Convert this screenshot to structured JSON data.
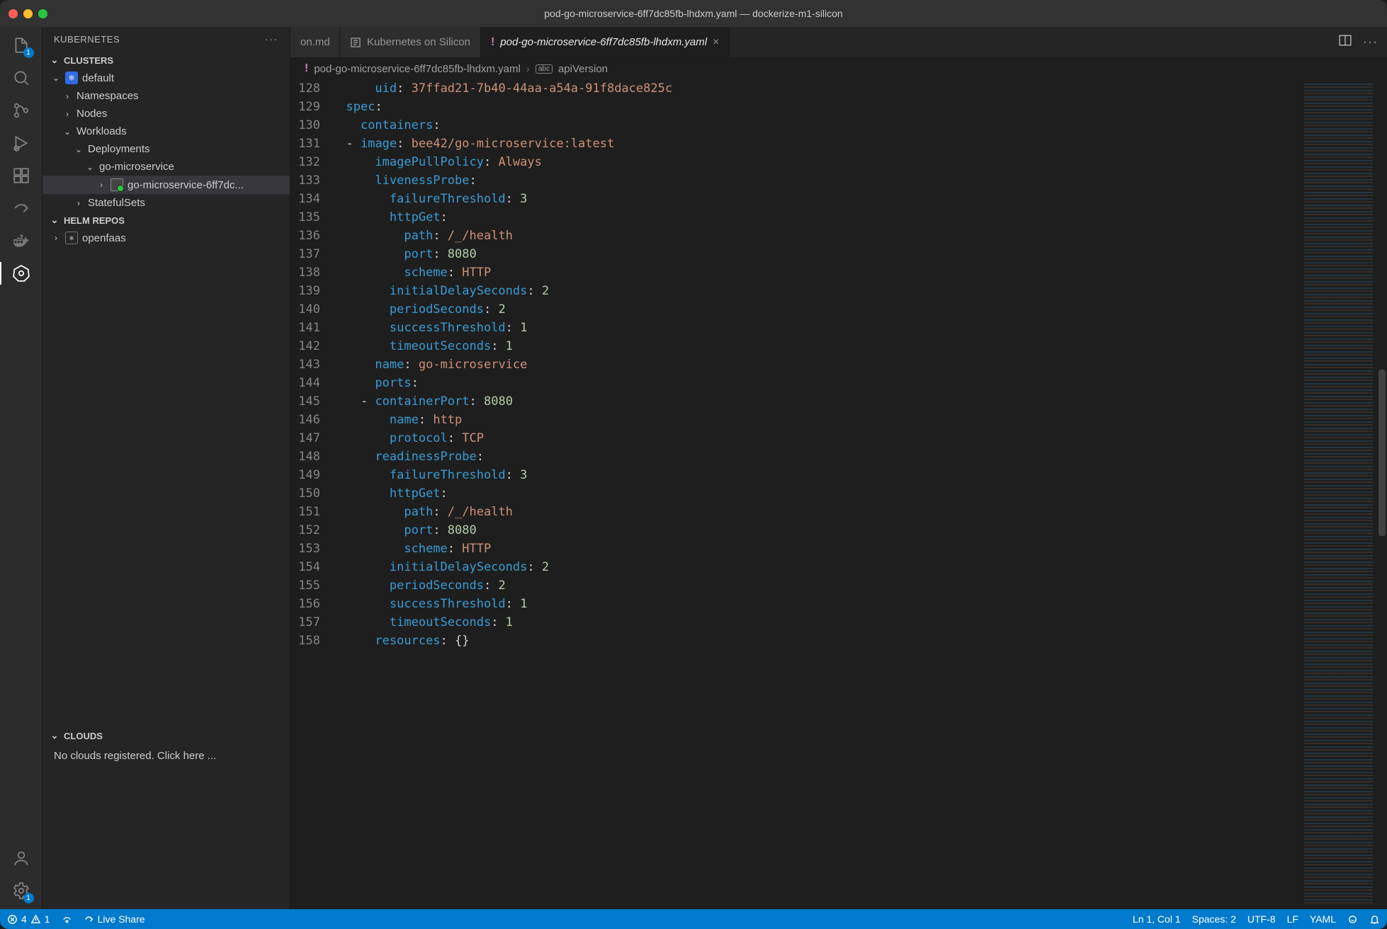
{
  "window": {
    "title": "pod-go-microservice-6ff7dc85fb-lhdxm.yaml — dockerize-m1-silicon"
  },
  "activity": {
    "explorer_badge": "1",
    "settings_badge": "1"
  },
  "sidebar": {
    "title": "KUBERNETES",
    "sections": {
      "clusters": "CLUSTERS",
      "helm": "HELM REPOS",
      "clouds": "CLOUDS"
    },
    "tree": {
      "cluster": "default",
      "namespaces": "Namespaces",
      "nodes": "Nodes",
      "workloads": "Workloads",
      "deployments": "Deployments",
      "deployment": "go-microservice",
      "pod": "go-microservice-6ff7dc...",
      "statefulsets": "StatefulSets",
      "helm_repo": "openfaas"
    },
    "clouds_msg": "No clouds registered. Click here ..."
  },
  "tabs": {
    "t0_label": "on.md",
    "t1_label": "Kubernetes on Silicon",
    "t2_label": "pod-go-microservice-6ff7dc85fb-lhdxm.yaml"
  },
  "breadcrumb": {
    "file": "pod-go-microservice-6ff7dc85fb-lhdxm.yaml",
    "symbol": "apiVersion"
  },
  "code": {
    "lines": [
      {
        "n": "128",
        "indent": 2,
        "key": "uid",
        "sep": ": ",
        "val": "37ffad21-7b40-44aa-a54a-91f8dace825c",
        "vt": "s"
      },
      {
        "n": "129",
        "indent": 0,
        "key": "spec",
        "sep": ":",
        "val": "",
        "vt": ""
      },
      {
        "n": "130",
        "indent": 1,
        "key": "containers",
        "sep": ":",
        "val": "",
        "vt": ""
      },
      {
        "n": "131",
        "indent": 1,
        "dash": true,
        "key": "image",
        "sep": ": ",
        "val": "bee42/go-microservice:latest",
        "vt": "s"
      },
      {
        "n": "132",
        "indent": 2,
        "key": "imagePullPolicy",
        "sep": ": ",
        "val": "Always",
        "vt": "s"
      },
      {
        "n": "133",
        "indent": 2,
        "key": "livenessProbe",
        "sep": ":",
        "val": "",
        "vt": ""
      },
      {
        "n": "134",
        "indent": 3,
        "key": "failureThreshold",
        "sep": ": ",
        "val": "3",
        "vt": "n"
      },
      {
        "n": "135",
        "indent": 3,
        "key": "httpGet",
        "sep": ":",
        "val": "",
        "vt": ""
      },
      {
        "n": "136",
        "indent": 4,
        "key": "path",
        "sep": ": ",
        "val": "/_/health",
        "vt": "s"
      },
      {
        "n": "137",
        "indent": 4,
        "key": "port",
        "sep": ": ",
        "val": "8080",
        "vt": "n"
      },
      {
        "n": "138",
        "indent": 4,
        "key": "scheme",
        "sep": ": ",
        "val": "HTTP",
        "vt": "s"
      },
      {
        "n": "139",
        "indent": 3,
        "key": "initialDelaySeconds",
        "sep": ": ",
        "val": "2",
        "vt": "n"
      },
      {
        "n": "140",
        "indent": 3,
        "key": "periodSeconds",
        "sep": ": ",
        "val": "2",
        "vt": "n"
      },
      {
        "n": "141",
        "indent": 3,
        "key": "successThreshold",
        "sep": ": ",
        "val": "1",
        "vt": "n"
      },
      {
        "n": "142",
        "indent": 3,
        "key": "timeoutSeconds",
        "sep": ": ",
        "val": "1",
        "vt": "n"
      },
      {
        "n": "143",
        "indent": 2,
        "key": "name",
        "sep": ": ",
        "val": "go-microservice",
        "vt": "s"
      },
      {
        "n": "144",
        "indent": 2,
        "key": "ports",
        "sep": ":",
        "val": "",
        "vt": ""
      },
      {
        "n": "145",
        "indent": 2,
        "dash": true,
        "key": "containerPort",
        "sep": ": ",
        "val": "8080",
        "vt": "n"
      },
      {
        "n": "146",
        "indent": 3,
        "key": "name",
        "sep": ": ",
        "val": "http",
        "vt": "s"
      },
      {
        "n": "147",
        "indent": 3,
        "key": "protocol",
        "sep": ": ",
        "val": "TCP",
        "vt": "s"
      },
      {
        "n": "148",
        "indent": 2,
        "key": "readinessProbe",
        "sep": ":",
        "val": "",
        "vt": ""
      },
      {
        "n": "149",
        "indent": 3,
        "key": "failureThreshold",
        "sep": ": ",
        "val": "3",
        "vt": "n"
      },
      {
        "n": "150",
        "indent": 3,
        "key": "httpGet",
        "sep": ":",
        "val": "",
        "vt": ""
      },
      {
        "n": "151",
        "indent": 4,
        "key": "path",
        "sep": ": ",
        "val": "/_/health",
        "vt": "s"
      },
      {
        "n": "152",
        "indent": 4,
        "key": "port",
        "sep": ": ",
        "val": "8080",
        "vt": "n"
      },
      {
        "n": "153",
        "indent": 4,
        "key": "scheme",
        "sep": ": ",
        "val": "HTTP",
        "vt": "s"
      },
      {
        "n": "154",
        "indent": 3,
        "key": "initialDelaySeconds",
        "sep": ": ",
        "val": "2",
        "vt": "n"
      },
      {
        "n": "155",
        "indent": 3,
        "key": "periodSeconds",
        "sep": ": ",
        "val": "2",
        "vt": "n"
      },
      {
        "n": "156",
        "indent": 3,
        "key": "successThreshold",
        "sep": ": ",
        "val": "1",
        "vt": "n"
      },
      {
        "n": "157",
        "indent": 3,
        "key": "timeoutSeconds",
        "sep": ": ",
        "val": "1",
        "vt": "n"
      },
      {
        "n": "158",
        "indent": 2,
        "key": "resources",
        "sep": ": ",
        "val": "{}",
        "vt": "p"
      }
    ]
  },
  "status": {
    "errors": "4",
    "warnings": "1",
    "live_share": "Live Share",
    "cursor": "Ln 1, Col 1",
    "spaces": "Spaces: 2",
    "encoding": "UTF-8",
    "eol": "LF",
    "lang": "YAML"
  }
}
